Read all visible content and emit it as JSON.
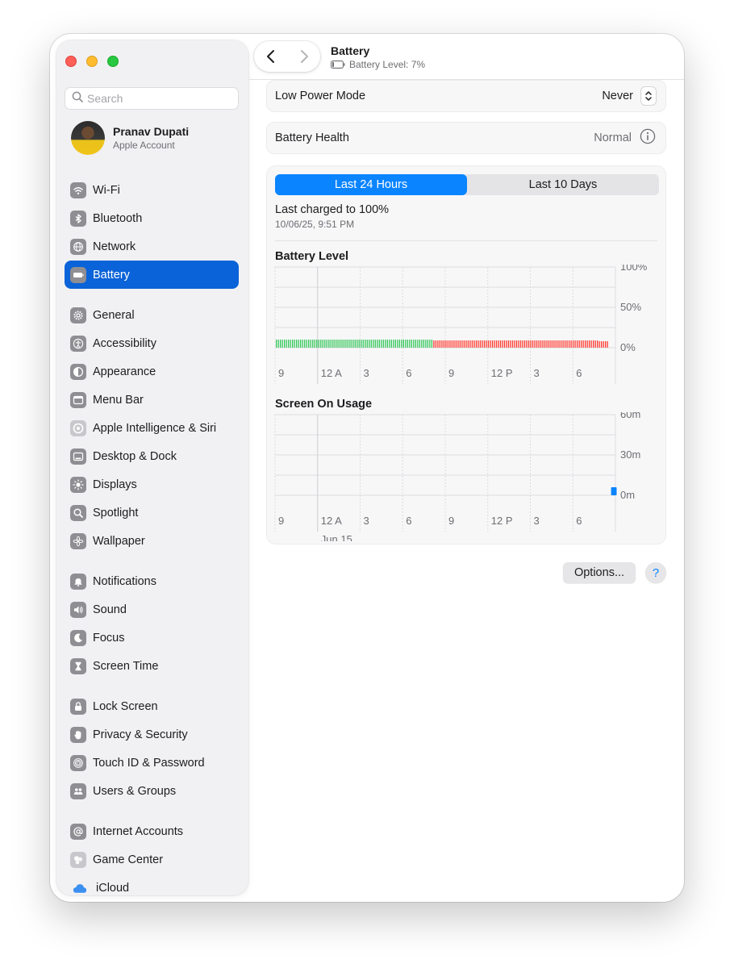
{
  "window": {
    "title": "Battery",
    "subtitle": "Battery Level: 7%"
  },
  "search": {
    "placeholder": "Search"
  },
  "account": {
    "name": "Pranav Dupati",
    "sub": "Apple Account"
  },
  "sidebar": {
    "items": [
      {
        "label": "Wi-Fi",
        "icon": "wifi-icon",
        "color": "#8e8e93",
        "active": false
      },
      {
        "label": "Bluetooth",
        "icon": "bluetooth-icon",
        "color": "#8e8e93",
        "active": false
      },
      {
        "label": "Network",
        "icon": "globe-icon",
        "color": "#8e8e93",
        "active": false
      },
      {
        "label": "Battery",
        "icon": "battery-icon",
        "color": "#8e8e93",
        "active": true
      },
      {
        "label": "General",
        "icon": "gear-icon",
        "color": "#8e8e93",
        "active": false
      },
      {
        "label": "Accessibility",
        "icon": "accessibility-icon",
        "color": "#8e8e93",
        "active": false
      },
      {
        "label": "Appearance",
        "icon": "appearance-icon",
        "color": "#8e8e93",
        "active": false
      },
      {
        "label": "Menu Bar",
        "icon": "menu-bar-icon",
        "color": "#8e8e93",
        "active": false
      },
      {
        "label": "Apple Intelligence & Siri",
        "icon": "siri-icon",
        "color": "#c8c8cc",
        "active": false
      },
      {
        "label": "Desktop & Dock",
        "icon": "dock-icon",
        "color": "#8e8e93",
        "active": false
      },
      {
        "label": "Displays",
        "icon": "sun-icon",
        "color": "#8e8e93",
        "active": false
      },
      {
        "label": "Spotlight",
        "icon": "magnifier-icon",
        "color": "#8e8e93",
        "active": false
      },
      {
        "label": "Wallpaper",
        "icon": "flower-icon",
        "color": "#8e8e93",
        "active": false
      },
      {
        "label": "Notifications",
        "icon": "bell-icon",
        "color": "#8e8e93",
        "active": false
      },
      {
        "label": "Sound",
        "icon": "speaker-icon",
        "color": "#8e8e93",
        "active": false
      },
      {
        "label": "Focus",
        "icon": "moon-icon",
        "color": "#8e8e93",
        "active": false
      },
      {
        "label": "Screen Time",
        "icon": "hourglass-icon",
        "color": "#8e8e93",
        "active": false
      },
      {
        "label": "Lock Screen",
        "icon": "lock-icon",
        "color": "#8e8e93",
        "active": false
      },
      {
        "label": "Privacy & Security",
        "icon": "hand-icon",
        "color": "#8e8e93",
        "active": false
      },
      {
        "label": "Touch ID & Password",
        "icon": "fingerprint-icon",
        "color": "#8e8e93",
        "active": false
      },
      {
        "label": "Users & Groups",
        "icon": "users-icon",
        "color": "#8e8e93",
        "active": false
      },
      {
        "label": "Internet Accounts",
        "icon": "at-icon",
        "color": "#8e8e93",
        "active": false
      },
      {
        "label": "Game Center",
        "icon": "game-center-icon",
        "color": "#c8c8cc",
        "active": false
      },
      {
        "label": "iCloud",
        "icon": "cloud-icon",
        "color": "#3b8ff0",
        "active": false
      }
    ]
  },
  "low_power": {
    "label": "Low Power Mode",
    "value": "Never"
  },
  "health": {
    "label": "Battery Health",
    "value": "Normal"
  },
  "tabs": {
    "left": "Last 24 Hours",
    "right": "Last 10 Days",
    "selected": "left"
  },
  "charged": {
    "main": "Last charged to 100%",
    "date": "10/06/25, 9:51 PM"
  },
  "buttons": {
    "options": "Options...",
    "help": "?"
  },
  "colors": {
    "accent": "#0a84ff",
    "green": "#34c759",
    "red": "#ff3b30",
    "sidebar_active": "#0a63d8"
  },
  "chart_data": [
    {
      "type": "bar",
      "title": "Battery Level",
      "y_ticks": [
        "100%",
        "50%",
        "0%"
      ],
      "ylim": [
        0,
        100
      ],
      "x_ticks": [
        "9",
        "12 A",
        "3",
        "6",
        "9",
        "12 P",
        "3",
        "6"
      ],
      "series": [
        {
          "color": "#34c759",
          "values": [
            10,
            10,
            10,
            10,
            10,
            10,
            10,
            10,
            10,
            10,
            10,
            10,
            10,
            10,
            10,
            10,
            10,
            10,
            10,
            10,
            10,
            10,
            10,
            10,
            10,
            10,
            10,
            10,
            10,
            10,
            10,
            10,
            10,
            10,
            10,
            10,
            10,
            10,
            10,
            10,
            10,
            10,
            10,
            10,
            10,
            10,
            10,
            10,
            10,
            10,
            10,
            10,
            10,
            10,
            10,
            10,
            10,
            10,
            10,
            10,
            10,
            10,
            10,
            10,
            10,
            10,
            10,
            10,
            10,
            10,
            10,
            10,
            10,
            10,
            10,
            10,
            10,
            10
          ]
        },
        {
          "color": "#ff3b30",
          "values": [
            9,
            9,
            9,
            9,
            9,
            9,
            9,
            9,
            9,
            9,
            9,
            9,
            9,
            9,
            9,
            9,
            9,
            9,
            9,
            9,
            9,
            9,
            9,
            9,
            9,
            9,
            9,
            9,
            9,
            9,
            9,
            9,
            9,
            9,
            9,
            9,
            9,
            9,
            9,
            9,
            9,
            9,
            9,
            9,
            9,
            9,
            9,
            9,
            9,
            9,
            9,
            9,
            9,
            9,
            9,
            9,
            9,
            9,
            9,
            9,
            9,
            9,
            9,
            9,
            9,
            9,
            9,
            9,
            9,
            9,
            9,
            9,
            9,
            9,
            9,
            9,
            9,
            9,
            9,
            9,
            9,
            9,
            8,
            8,
            8,
            8,
            8
          ]
        }
      ],
      "grid": true
    },
    {
      "type": "bar",
      "title": "Screen On Usage",
      "y_ticks": [
        "60m",
        "30m",
        "0m"
      ],
      "ylim": [
        0,
        60
      ],
      "x_ticks": [
        "9",
        "12 A",
        "3",
        "6",
        "9",
        "12 P",
        "3",
        "6"
      ],
      "date_label": "Jun 15",
      "series": [
        {
          "color": "#0a84ff",
          "values": [
            0,
            0,
            0,
            0,
            0,
            0,
            0,
            0,
            0,
            0,
            0,
            0,
            0,
            0,
            0,
            0,
            0,
            0,
            0,
            0,
            0,
            0,
            0,
            0,
            0,
            0,
            0,
            0,
            0,
            0,
            0,
            0,
            0,
            0,
            0,
            0,
            0,
            0,
            0,
            0,
            0,
            0,
            0,
            0,
            0,
            0,
            0,
            0,
            0,
            0,
            0,
            0,
            0,
            0,
            0,
            0,
            0,
            0,
            0,
            0,
            0,
            0,
            0,
            0,
            0,
            0,
            0,
            0,
            0,
            0,
            0,
            0,
            0,
            0,
            0,
            0,
            0,
            0,
            0,
            0,
            0,
            0,
            0,
            0,
            0,
            0,
            0,
            0,
            0,
            0,
            0,
            0,
            0,
            0,
            6
          ]
        }
      ],
      "grid": true
    }
  ]
}
